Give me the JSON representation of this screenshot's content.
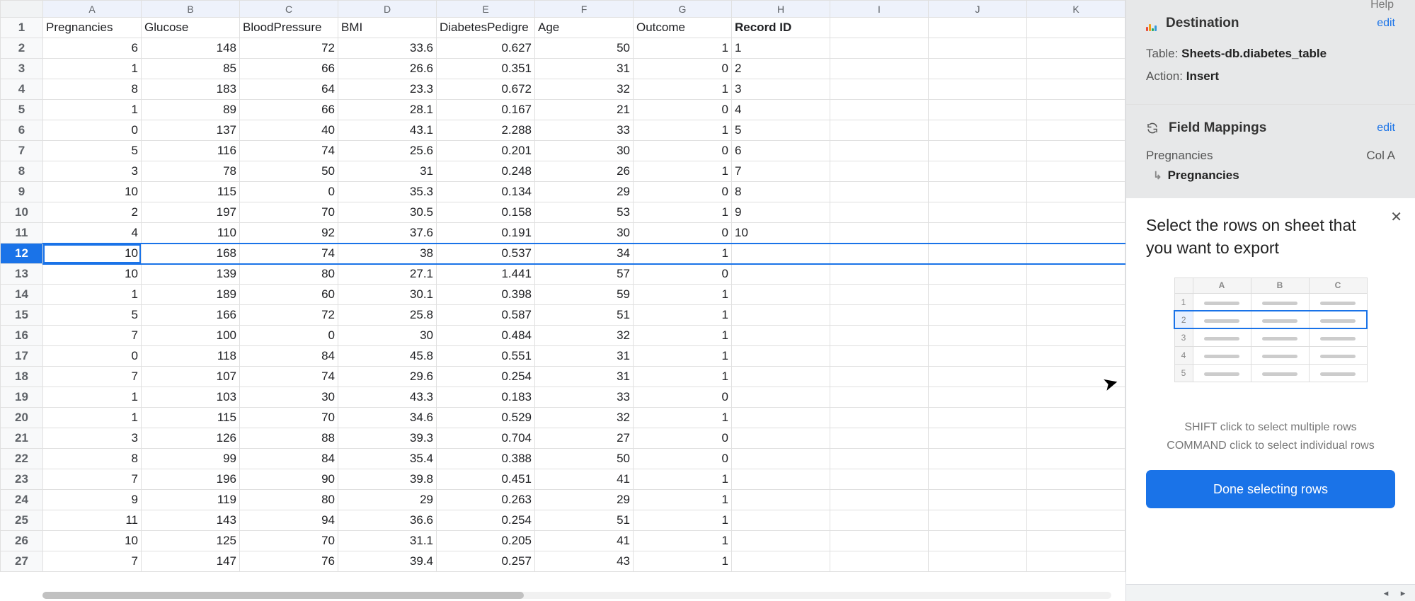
{
  "help_label": "Help",
  "columns": [
    "A",
    "B",
    "C",
    "D",
    "E",
    "F",
    "G",
    "H",
    "I",
    "J",
    "K"
  ],
  "headers": [
    "Pregnancies",
    "Glucose",
    "BloodPressure",
    "BMI",
    "DiabetesPedigree",
    "Age",
    "Outcome",
    "Record ID",
    "",
    "",
    ""
  ],
  "header_truncated_col5": "DiabetesPedigre",
  "selected_row": 12,
  "rows": [
    [
      6,
      148,
      72,
      33.6,
      0.627,
      50,
      1,
      "1",
      "",
      "",
      ""
    ],
    [
      1,
      85,
      66,
      26.6,
      0.351,
      31,
      0,
      "2",
      "",
      "",
      ""
    ],
    [
      8,
      183,
      64,
      23.3,
      0.672,
      32,
      1,
      "3",
      "",
      "",
      ""
    ],
    [
      1,
      89,
      66,
      28.1,
      0.167,
      21,
      0,
      "4",
      "",
      "",
      ""
    ],
    [
      0,
      137,
      40,
      43.1,
      2.288,
      33,
      1,
      "5",
      "",
      "",
      ""
    ],
    [
      5,
      116,
      74,
      25.6,
      0.201,
      30,
      0,
      "6",
      "",
      "",
      ""
    ],
    [
      3,
      78,
      50,
      31,
      0.248,
      26,
      1,
      "7",
      "",
      "",
      ""
    ],
    [
      10,
      115,
      0,
      35.3,
      0.134,
      29,
      0,
      "8",
      "",
      "",
      ""
    ],
    [
      2,
      197,
      70,
      30.5,
      0.158,
      53,
      1,
      "9",
      "",
      "",
      ""
    ],
    [
      4,
      110,
      92,
      37.6,
      0.191,
      30,
      0,
      "10",
      "",
      "",
      ""
    ],
    [
      10,
      168,
      74,
      38,
      0.537,
      34,
      1,
      "",
      "",
      "",
      ""
    ],
    [
      10,
      139,
      80,
      27.1,
      1.441,
      57,
      0,
      "",
      "",
      "",
      ""
    ],
    [
      1,
      189,
      60,
      30.1,
      0.398,
      59,
      1,
      "",
      "",
      "",
      ""
    ],
    [
      5,
      166,
      72,
      25.8,
      0.587,
      51,
      1,
      "",
      "",
      "",
      ""
    ],
    [
      7,
      100,
      0,
      30,
      0.484,
      32,
      1,
      "",
      "",
      "",
      ""
    ],
    [
      0,
      118,
      84,
      45.8,
      0.551,
      31,
      1,
      "",
      "",
      "",
      ""
    ],
    [
      7,
      107,
      74,
      29.6,
      0.254,
      31,
      1,
      "",
      "",
      "",
      ""
    ],
    [
      1,
      103,
      30,
      43.3,
      0.183,
      33,
      0,
      "",
      "",
      "",
      ""
    ],
    [
      1,
      115,
      70,
      34.6,
      0.529,
      32,
      1,
      "",
      "",
      "",
      ""
    ],
    [
      3,
      126,
      88,
      39.3,
      0.704,
      27,
      0,
      "",
      "",
      "",
      ""
    ],
    [
      8,
      99,
      84,
      35.4,
      0.388,
      50,
      0,
      "",
      "",
      "",
      ""
    ],
    [
      7,
      196,
      90,
      39.8,
      0.451,
      41,
      1,
      "",
      "",
      "",
      ""
    ],
    [
      9,
      119,
      80,
      29,
      0.263,
      29,
      1,
      "",
      "",
      "",
      ""
    ],
    [
      11,
      143,
      94,
      36.6,
      0.254,
      51,
      1,
      "",
      "",
      "",
      ""
    ],
    [
      10,
      125,
      70,
      31.1,
      0.205,
      41,
      1,
      "",
      "",
      "",
      ""
    ],
    [
      7,
      147,
      76,
      39.4,
      0.257,
      43,
      1,
      "",
      "",
      "",
      ""
    ]
  ],
  "side": {
    "destination": {
      "title": "Destination",
      "edit": "edit",
      "table_label": "Table:",
      "table_value": "Sheets-db.diabetes_table",
      "action_label": "Action:",
      "action_value": "Insert"
    },
    "mappings": {
      "title": "Field Mappings",
      "edit": "edit",
      "field_src": "Pregnancies",
      "field_col": "Col A",
      "field_dst": "Pregnancies"
    },
    "popup": {
      "title": "Select the rows on sheet that you want to export",
      "hint1": "SHIFT click to select multiple rows",
      "hint2": "COMMAND click to select individual rows",
      "done": "Done selecting rows",
      "illus_cols": [
        "A",
        "B",
        "C"
      ],
      "illus_rows": [
        "1",
        "2",
        "3",
        "4",
        "5"
      ]
    }
  }
}
